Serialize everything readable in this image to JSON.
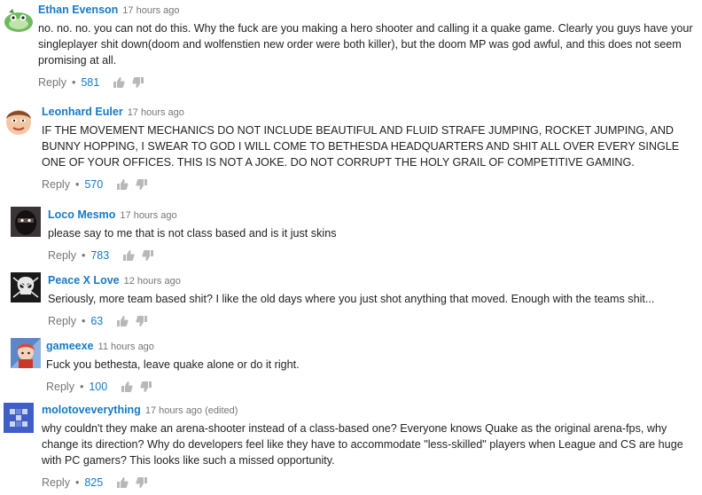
{
  "comments": [
    {
      "author": "Ethan Evenson",
      "time": "17 hours ago",
      "text": "no.  no.  no.  you can not do this.  Why the fuck are you making a hero shooter and calling it a quake game.  Clearly you guys have your singleplayer shit down(doom and wolfenstien new order were both killer), but the doom MP was god awful, and this does not seem promising at all.",
      "reply": "Reply",
      "likes": "581",
      "avatar_icon": "green-blob-avatar"
    },
    {
      "author": "Leonhard Euler",
      "time": "17 hours ago",
      "text": "IF THE MOVEMENT MECHANICS DO NOT INCLUDE BEAUTIFUL AND FLUID STRAFE JUMPING, ROCKET JUMPING, AND BUNNY HOPPING, I SWEAR TO GOD I WILL COME TO BETHESDA HEADQUARTERS AND SHIT ALL OVER EVERY SINGLE ONE OF YOUR OFFICES. THIS IS NOT A JOKE. DO NOT CORRUPT THE HOLY GRAIL OF COMPETITIVE GAMING.",
      "reply": "Reply",
      "likes": "570",
      "avatar_icon": "cartoon-face-avatar"
    },
    {
      "author": "Loco Mesmo",
      "time": "17 hours ago",
      "text": "please say to me that is not class based and is it just skins",
      "reply": "Reply",
      "likes": "783",
      "avatar_icon": "masked-figure-avatar"
    },
    {
      "author": "Peace X Love",
      "time": "12 hours ago",
      "text": "Seriously, more team based shit? I like the old days where you just shot anything that moved. Enough with the teams shit...",
      "reply": "Reply",
      "likes": "63",
      "avatar_icon": "skull-logo-avatar"
    },
    {
      "author": "gameexe",
      "time": "11 hours ago",
      "text": "Fuck you bethesta, leave quake alone or do it right.",
      "reply": "Reply",
      "likes": "100",
      "avatar_icon": "anime-character-avatar"
    },
    {
      "author": "molotoveverything",
      "time": "17 hours ago (edited)",
      "text": "why couldn't they make an arena-shooter instead of a class-based one? Everyone knows Quake as the original arena-fps, why change its direction? Why do developers feel like they have to accommodate \"less-skilled\" players when League and CS are huge with PC gamers? This looks like such a missed opportunity.",
      "reply": "Reply",
      "likes": "825",
      "avatar_icon": "blue-grid-avatar"
    }
  ],
  "colors": {
    "link": "#167ac6",
    "meta": "#767676",
    "text": "#222222",
    "icon": "#b8b8b8"
  }
}
